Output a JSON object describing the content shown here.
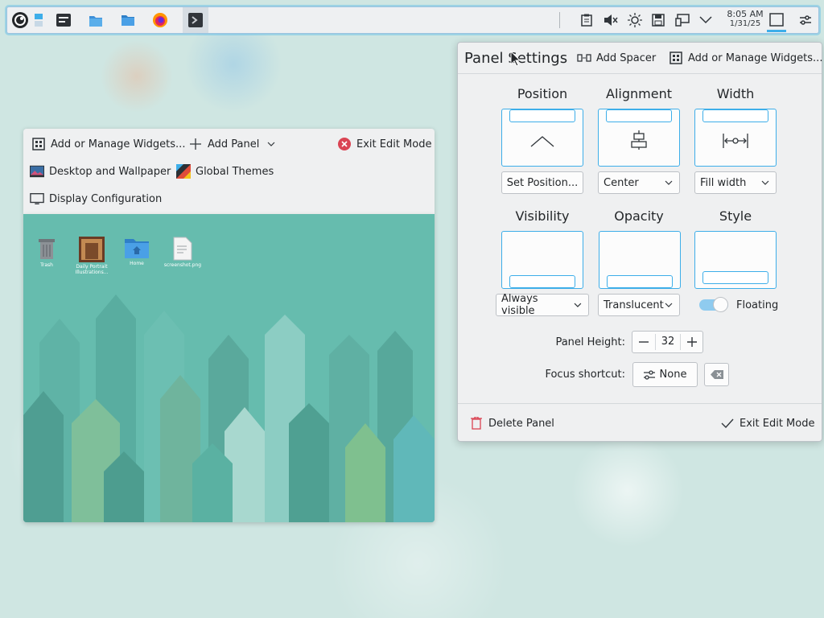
{
  "taskbar": {
    "clock_time": "8:05 AM",
    "clock_date": "1/31/25",
    "launchers": [
      "application-launcher-icon",
      "overview-icon",
      "dolphin-icon",
      "file-manager-icon",
      "firefox-icon",
      "konsole-icon"
    ],
    "tray": [
      "clipboard-icon",
      "volume-muted-icon",
      "brightness-icon",
      "storage-icon",
      "network-icon",
      "chevron-down-icon"
    ]
  },
  "edit_toolbar": {
    "add_widgets": "Add or Manage Widgets...",
    "add_panel": "Add Panel",
    "exit_edit": "Exit Edit Mode",
    "wallpaper": "Desktop and Wallpaper",
    "themes": "Global Themes",
    "display": "Display Configuration"
  },
  "desktop_icons": [
    {
      "label": "Trash",
      "icon": "trash-icon"
    },
    {
      "label": "Daily Portrait Illustrations...",
      "icon": "image-file-icon"
    },
    {
      "label": "Home",
      "icon": "home-folder-icon"
    },
    {
      "label": "screenshot.png",
      "icon": "text-file-icon"
    }
  ],
  "panel_settings": {
    "title": "Panel Settings",
    "add_spacer": "Add Spacer",
    "add_widgets": "Add or Manage Widgets...",
    "position": {
      "label": "Position",
      "button": "Set Position..."
    },
    "alignment": {
      "label": "Alignment",
      "value": "Center"
    },
    "width": {
      "label": "Width",
      "value": "Fill width"
    },
    "visibility": {
      "label": "Visibility",
      "value": "Always visible"
    },
    "opacity": {
      "label": "Opacity",
      "value": "Translucent"
    },
    "style": {
      "label": "Style",
      "floating_label": "Floating",
      "floating_on": true
    },
    "panel_height": {
      "label": "Panel Height:",
      "value": "32"
    },
    "focus_shortcut": {
      "label": "Focus shortcut:",
      "value": "None"
    },
    "delete_panel": "Delete Panel",
    "exit_edit": "Exit Edit Mode"
  },
  "colors": {
    "accent": "#3daee9",
    "desktop": "#66bcae",
    "danger": "#da4453"
  }
}
